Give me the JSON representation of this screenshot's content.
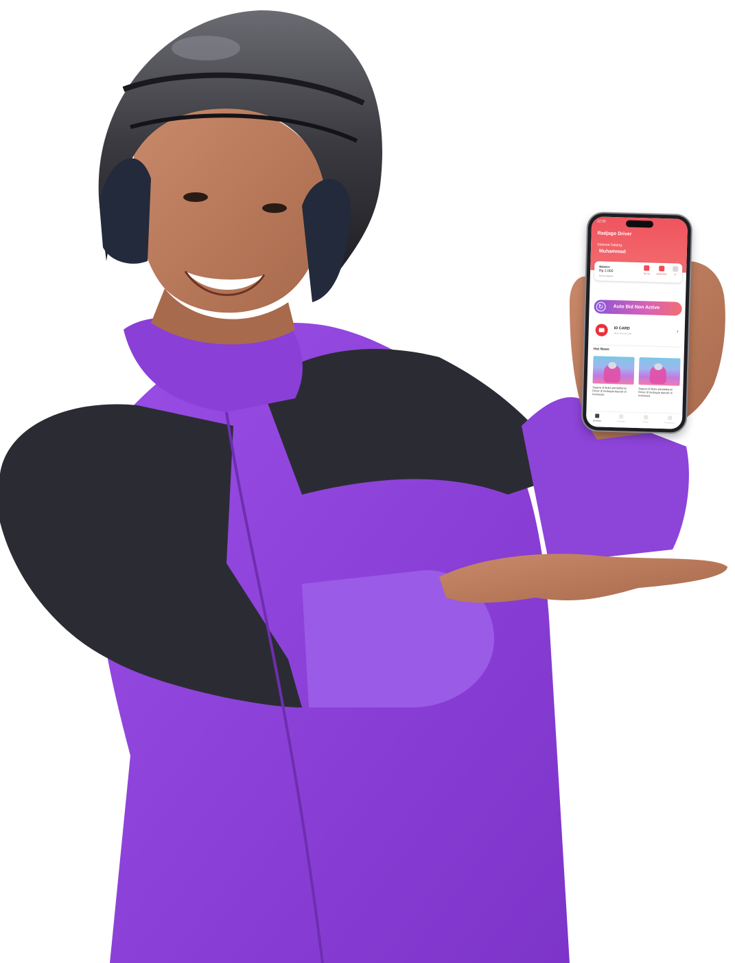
{
  "app": {
    "status_time": "12:35",
    "title": "Radjago Driver",
    "greeting": "Selamat Datang,",
    "driver_name": "Muhammad",
    "balance": {
      "label": "Balance",
      "amount": "Rp 2.000",
      "sub": "Money Balance"
    },
    "actions": [
      {
        "label": "Top Up",
        "icon": "wallet-icon"
      },
      {
        "label": "Withdrawal",
        "icon": "withdraw-icon"
      },
      {
        "label": "ID",
        "icon": "id-icon"
      }
    ],
    "auto_bid": {
      "label": "Auto Bid Non Active",
      "icon": "refresh-icon"
    },
    "id_card": {
      "title": "ID CARD",
      "subtitle": "Show Your ID Card",
      "icon": "id-card-icon"
    },
    "hot_news": {
      "title": "Hot News",
      "items": [
        {
          "caption": "Segera di Buka pendaftaran Driver di berbagai daerah di Indonesia"
        },
        {
          "caption": "Segera di Buka pendaftaran Driver di berbagai daerah di Indonesia"
        }
      ]
    },
    "nav": [
      {
        "label": "Beranda",
        "icon": "home-icon",
        "active": true
      },
      {
        "label": "Pesanan",
        "icon": "orders-icon",
        "active": false
      },
      {
        "label": "Notice",
        "icon": "bell-icon",
        "active": false
      },
      {
        "label": "Pengaturan",
        "icon": "profile-icon",
        "active": false
      }
    ]
  },
  "colors": {
    "brand_red": "#f0545e",
    "jacket_purple": "#8a3fd6",
    "jacket_black": "#2b2c33",
    "skin": "#b8795a"
  }
}
